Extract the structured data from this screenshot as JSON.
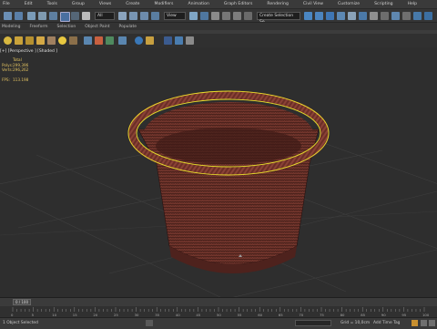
{
  "menu": {
    "items": [
      "File",
      "Edit",
      "Tools",
      "Group",
      "Views",
      "Create",
      "Modifiers",
      "Animation",
      "Graph Editors",
      "Rendering",
      "Civil View",
      "Customize",
      "Scripting",
      "Help"
    ]
  },
  "toolbar": {
    "selection_filter": "All",
    "view_dropdown": "View",
    "selection_set_dropdown": "Create Selection Se"
  },
  "ribbon": {
    "tabs": [
      "Modeling",
      "Freeform",
      "Selection",
      "Object Paint",
      "Populate"
    ]
  },
  "viewport": {
    "label": "[+] [Perspective ] [Shaded ]",
    "stats": {
      "header": "Total",
      "polys_label": "Polys:",
      "polys_value": "299,396",
      "verts_label": "Verts:",
      "verts_value": "296,262",
      "fps_label": "FPS:",
      "fps_value": "113.198"
    }
  },
  "timeline": {
    "slider": "0 / 100",
    "ticks": [
      "0",
      "5",
      "10",
      "15",
      "20",
      "25",
      "30",
      "35",
      "40",
      "45",
      "50",
      "55",
      "60",
      "65",
      "70",
      "75",
      "80",
      "85",
      "90",
      "95",
      "100"
    ]
  },
  "status": {
    "message": "1 Object Selected",
    "grid": "Grid = 10,0cm",
    "add_time_tag": "Add Time Tag"
  },
  "colors": {
    "selection": "#e8e02a",
    "basket": "#5e2a22",
    "viewport_bg": "#2e2e2e"
  }
}
